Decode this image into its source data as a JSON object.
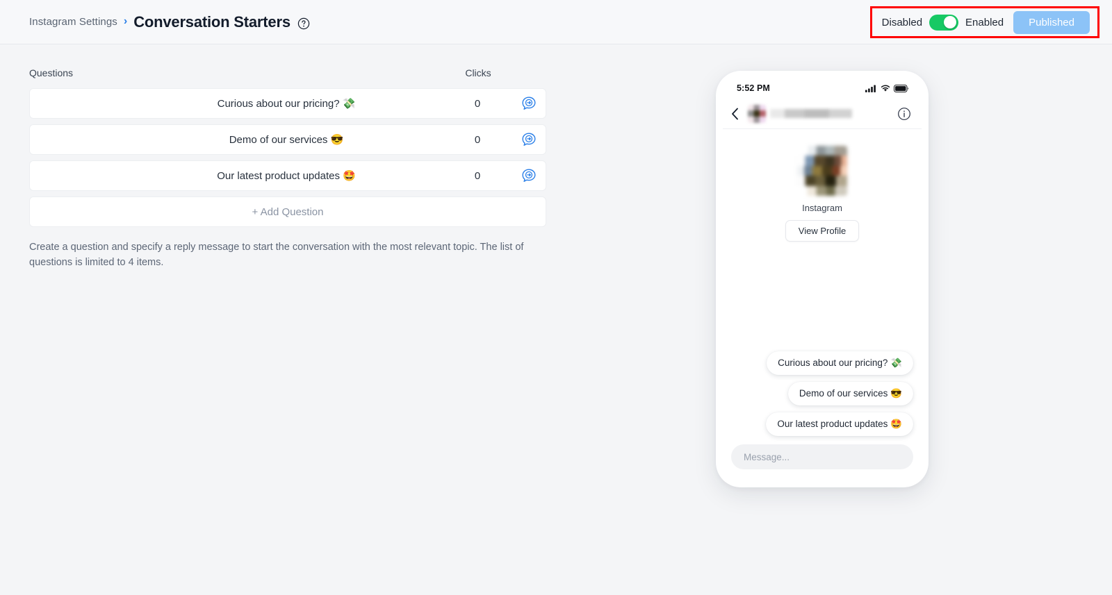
{
  "header": {
    "breadcrumb_parent": "Instagram Settings",
    "breadcrumb_separator": "›",
    "title": "Conversation Starters",
    "help_icon": "question-mark-circle-icon",
    "toggle": {
      "off_label": "Disabled",
      "on_label": "Enabled",
      "state": "enabled",
      "on_color": "#17c964"
    },
    "publish_button": {
      "label": "Published",
      "color": "#8cc3f7",
      "text_color": "#ffffff"
    },
    "annotation_box_color": "#ff0000"
  },
  "questions_panel": {
    "column_headers": {
      "questions": "Questions",
      "clicks": "Clicks"
    },
    "rows": [
      {
        "text": "Curious about our pricing? 💸",
        "clicks": "0",
        "action_icon": "message-arrow-icon"
      },
      {
        "text": "Demo of our services 😎",
        "clicks": "0",
        "action_icon": "message-arrow-icon"
      },
      {
        "text": "Our latest product updates 🤩",
        "clicks": "0",
        "action_icon": "message-arrow-icon"
      }
    ],
    "add_question_label": "+ Add Question",
    "helper_text": "Create a question and specify a reply message to start the conversation with the most relevant topic. The list of questions is limited to 4 items."
  },
  "phone_preview": {
    "status_bar": {
      "time": "5:52 PM",
      "icons": [
        "cellular-signal-icon",
        "wifi-icon",
        "battery-icon"
      ]
    },
    "nav_bar": {
      "back_icon": "chevron-left-icon",
      "peer_avatar": "blurred-avatar",
      "peer_name": "blurred-name",
      "info_icon": "info-circle-icon"
    },
    "profile": {
      "avatar": "blurred-profile-image",
      "name": "Instagram",
      "view_profile_label": "View Profile"
    },
    "starter_bubbles": [
      "Curious about our pricing? 💸",
      "Demo of our services 😎",
      "Our latest product updates 🤩"
    ],
    "message_input_placeholder": "Message..."
  }
}
